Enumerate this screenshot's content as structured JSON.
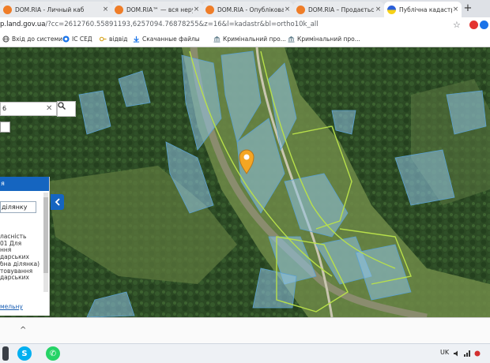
{
  "browser": {
    "tabs": [
      {
        "title": "DOM.RIA - Личный каб",
        "active": false
      },
      {
        "title": "DOM.RIA™ — вся неру",
        "active": false
      },
      {
        "title": "DOM.RIA - Опублікова",
        "active": false
      },
      {
        "title": "DOM.RIA – Продається",
        "active": false
      },
      {
        "title": "Публічна кадастрова к",
        "active": true
      }
    ],
    "new_tab": "+",
    "url": "p.land.gov.ua/?cc=2612760.55891193,6257094.76878255&z=16&l=kadastr&bl=ortho10k_all",
    "url_domain": "p.land.gov.ua",
    "url_path": "/?cc=2612760.55891193,6257094.76878255&z=16&l=kadastr&bl=ortho10k_all"
  },
  "bookmarks": [
    {
      "label": "Вхід до системи",
      "icon": "globe-icon"
    },
    {
      "label": "ІС СЕД",
      "icon": "sed-icon"
    },
    {
      "label": "відвід",
      "icon": "key-icon"
    },
    {
      "label": "Скачанные файлы",
      "icon": "download-icon"
    },
    {
      "label": "Кримінальний про...",
      "icon": "court-icon"
    },
    {
      "label": "Кримінальний про...",
      "icon": "court-icon"
    }
  ],
  "map": {
    "search_value": "6",
    "clear": "✕"
  },
  "panel": {
    "title": "я",
    "select_value": "ділянку",
    "lines": [
      "ласність",
      "01 Для",
      "ння",
      "дарських",
      "бна ділянка)",
      "товування",
      "дарських"
    ],
    "link": "мельну"
  },
  "download_bar": {
    "chevron": "^"
  },
  "taskbar": {
    "lang": "UK",
    "apps": [
      {
        "name": "skype",
        "label": "S"
      },
      {
        "name": "whatsapp",
        "label": "✆"
      }
    ]
  },
  "colors": {
    "accent": "#1565c0",
    "parcel_fill": "#8fc3e6",
    "parcel_stroke": "#5aa0d0",
    "boundary": "#b8e04a",
    "marker": "#f5a623"
  }
}
